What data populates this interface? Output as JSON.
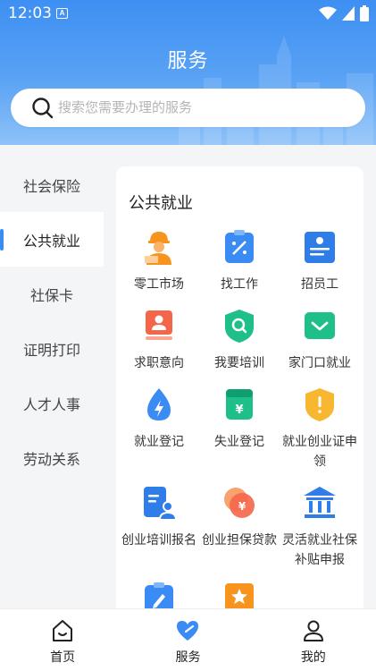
{
  "status_bar": {
    "time": "12:03",
    "badge": "A"
  },
  "header": {
    "title": "服务"
  },
  "search": {
    "placeholder": "搜索您需要办理的服务"
  },
  "sidebar": {
    "items": [
      {
        "label": "社会保险",
        "active": false
      },
      {
        "label": "公共就业",
        "active": true
      },
      {
        "label": "社保卡",
        "active": false
      },
      {
        "label": "证明打印",
        "active": false
      },
      {
        "label": "人才人事",
        "active": false
      },
      {
        "label": "劳动关系",
        "active": false
      }
    ]
  },
  "panel": {
    "title": "公共就业",
    "services": [
      {
        "label": "零工市场",
        "icon": "worker-icon"
      },
      {
        "label": "找工作",
        "icon": "find-job-icon"
      },
      {
        "label": "招员工",
        "icon": "recruit-icon"
      },
      {
        "label": "求职意向",
        "icon": "job-intent-icon"
      },
      {
        "label": "我要培训",
        "icon": "training-icon"
      },
      {
        "label": "家门口就业",
        "icon": "nearby-job-icon"
      },
      {
        "label": "就业登记",
        "icon": "employment-register-icon"
      },
      {
        "label": "失业登记",
        "icon": "unemployment-register-icon"
      },
      {
        "label": "就业创业证申领",
        "icon": "certificate-icon"
      },
      {
        "label": "创业培训报名",
        "icon": "startup-training-icon"
      },
      {
        "label": "创业担保贷款",
        "icon": "loan-icon"
      },
      {
        "label": "灵活就业社保补贴申报",
        "icon": "subsidy-icon"
      },
      {
        "label": "",
        "icon": "clipboard-icon"
      },
      {
        "label": "",
        "icon": "star-doc-icon"
      }
    ]
  },
  "tabbar": {
    "items": [
      {
        "label": "首页",
        "icon": "home-icon"
      },
      {
        "label": "服务",
        "icon": "service-heart-icon"
      },
      {
        "label": "我的",
        "icon": "profile-icon"
      }
    ]
  },
  "colors": {
    "primary": "#3b8bf4",
    "orange": "#f7941d",
    "green": "#1fbf8a",
    "red": "#f4664a"
  }
}
